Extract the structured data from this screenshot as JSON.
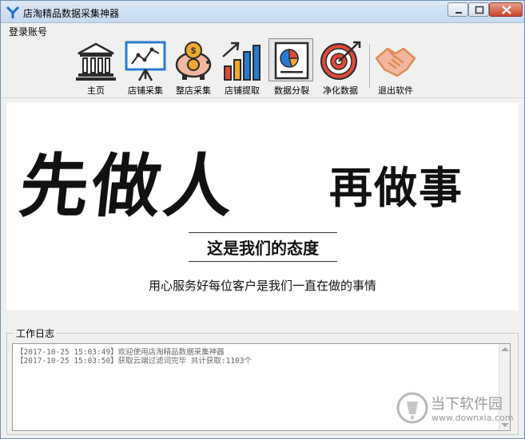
{
  "window": {
    "title": "店淘精品数据采集神器"
  },
  "menu": {
    "login": "登录账号"
  },
  "toolbar": {
    "items": [
      {
        "label": "主页",
        "icon": "bank-icon"
      },
      {
        "label": "店铺采集",
        "icon": "presentation-chart-icon"
      },
      {
        "label": "整店采集",
        "icon": "piggy-bank-icon"
      },
      {
        "label": "店铺提取",
        "icon": "bar-growth-icon"
      },
      {
        "label": "数据分裂",
        "icon": "pie-report-icon"
      },
      {
        "label": "净化数据",
        "icon": "target-icon"
      },
      {
        "label": "退出软件",
        "icon": "handshake-icon"
      }
    ],
    "active_index": 4
  },
  "banner": {
    "slogan_main": "先做人",
    "slogan_sub": "再做事",
    "attitude": "这是我们的态度",
    "service": "用心服务好每位客户是我们一直在做的事情"
  },
  "log": {
    "legend": "工作日志",
    "lines": [
      "【2017-10-25 15:03:49】欢迎使用店淘精品数据采集神器",
      "【2017-10-25 15:03:50】获取云端过滤词完毕 共计获取:1103个"
    ]
  },
  "watermark": {
    "name": "当下软件园",
    "url": "www.downxia.com"
  },
  "colors": {
    "icon_orange": "#f0a830",
    "icon_red": "#e04a3a",
    "icon_blue": "#2a7bd0",
    "icon_dark": "#2b2b2b"
  }
}
